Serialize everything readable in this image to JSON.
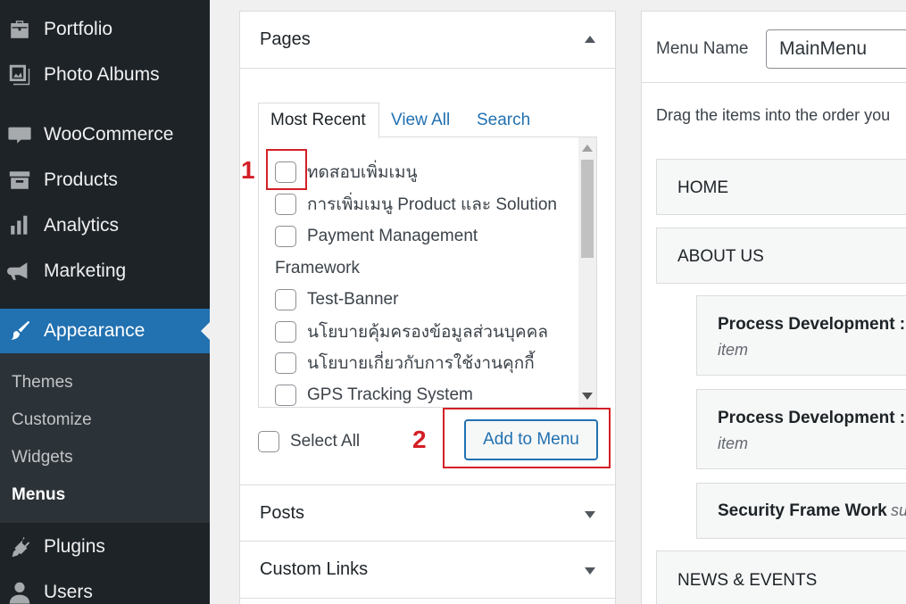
{
  "sidebar": {
    "items": [
      {
        "label": "Portfolio",
        "icon": "portfolio-icon"
      },
      {
        "label": "Photo Albums",
        "icon": "photo-albums-icon"
      },
      {
        "label": "WooCommerce",
        "icon": "woocommerce-icon"
      },
      {
        "label": "Products",
        "icon": "products-icon"
      },
      {
        "label": "Analytics",
        "icon": "analytics-icon"
      },
      {
        "label": "Marketing",
        "icon": "megaphone-icon"
      },
      {
        "label": "Appearance",
        "icon": "paintbrush-icon"
      },
      {
        "label": "Plugins",
        "icon": "plugin-icon"
      },
      {
        "label": "Users",
        "icon": "users-icon"
      }
    ],
    "submenu": [
      "Themes",
      "Customize",
      "Widgets",
      "Menus"
    ],
    "active_color": "#2271b1"
  },
  "pages_panel": {
    "title": "Pages",
    "tabs": [
      "Most Recent",
      "View All",
      "Search"
    ],
    "items": [
      "ทดสอบเพิ่มเมนู",
      "การเพิ่มเมนู Product และ Solution",
      "Payment Management",
      "Framework",
      "Test-Banner",
      "นโยบายคุ้มครองข้อมูลส่วนบุคคล",
      "นโยบายเกี่ยวกับการใช้งานคุกกี้",
      "GPS Tracking System"
    ],
    "select_all": "Select All",
    "add_button": "Add to Menu"
  },
  "other_panels": [
    "Posts",
    "Custom Links"
  ],
  "annotations": [
    "1",
    "2"
  ],
  "menu_editor": {
    "name_label": "Menu Name",
    "name_value": "MainMenu",
    "hint": "Drag the items into the order you",
    "items": [
      {
        "title": "HOME",
        "type": ""
      },
      {
        "title": "ABOUT US",
        "type": ""
      },
      {
        "title": "Process Development : C",
        "type": "item"
      },
      {
        "title": "Process Development : A",
        "type": "item"
      },
      {
        "title": "Security Frame Work",
        "type": "su"
      },
      {
        "title": "NEWS & EVENTS",
        "type": ""
      }
    ]
  }
}
